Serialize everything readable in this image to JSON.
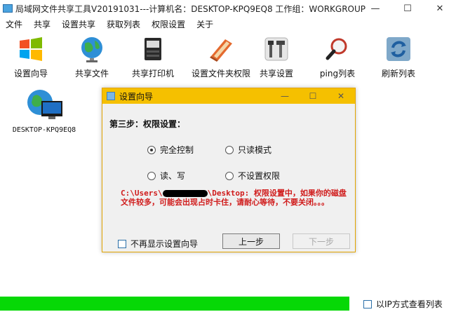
{
  "window": {
    "title": "局域网文件共享工具V20191031---计算机名：DESKTOP-KPQ9EQ8  工作组：WORKGROUP",
    "controls": {
      "minimize": "—",
      "maximize": "☐",
      "close": "✕"
    }
  },
  "menu": [
    "文件",
    "共享",
    "设置共享",
    "获取列表",
    "权限设置",
    "关于"
  ],
  "toolbar": [
    {
      "label": "设置向导",
      "icon": "windows-logo-icon"
    },
    {
      "label": "共享文件",
      "icon": "globe-icon"
    },
    {
      "label": "共享打印机",
      "icon": "printer-icon"
    },
    {
      "label": "设置文件夹权限",
      "icon": "folder-icon"
    },
    {
      "label": "共享设置",
      "icon": "tools-icon"
    },
    {
      "label": "ping列表",
      "icon": "magnifier-icon"
    },
    {
      "label": "刷新列表",
      "icon": "refresh-icon"
    }
  ],
  "computers": [
    {
      "name": "DESKTOP-KPQ9EQ8",
      "icon": "computer-icon"
    }
  ],
  "dialog": {
    "title": "设置向导",
    "step": "第三步：权限设置：",
    "options": [
      {
        "label": "完全控制",
        "checked": true
      },
      {
        "label": "只读模式",
        "checked": false
      },
      {
        "label": "读、写",
        "checked": false
      },
      {
        "label": "不设置权限",
        "checked": false
      }
    ],
    "warning_part1": "C:\\Users\\",
    "warning_part2": "\\Desktop: 权限设置中，如果你的磁盘文件较多，可能会出现占时卡住，请耐心等待，不要关闭。。。",
    "dont_show_label": "不再显示设置向导",
    "prev_button": "上一步",
    "next_button": "下一步"
  },
  "status": {
    "progress_percent": 100,
    "progress_color": "#06d806",
    "ip_view_label": "以IP方式查看列表"
  }
}
